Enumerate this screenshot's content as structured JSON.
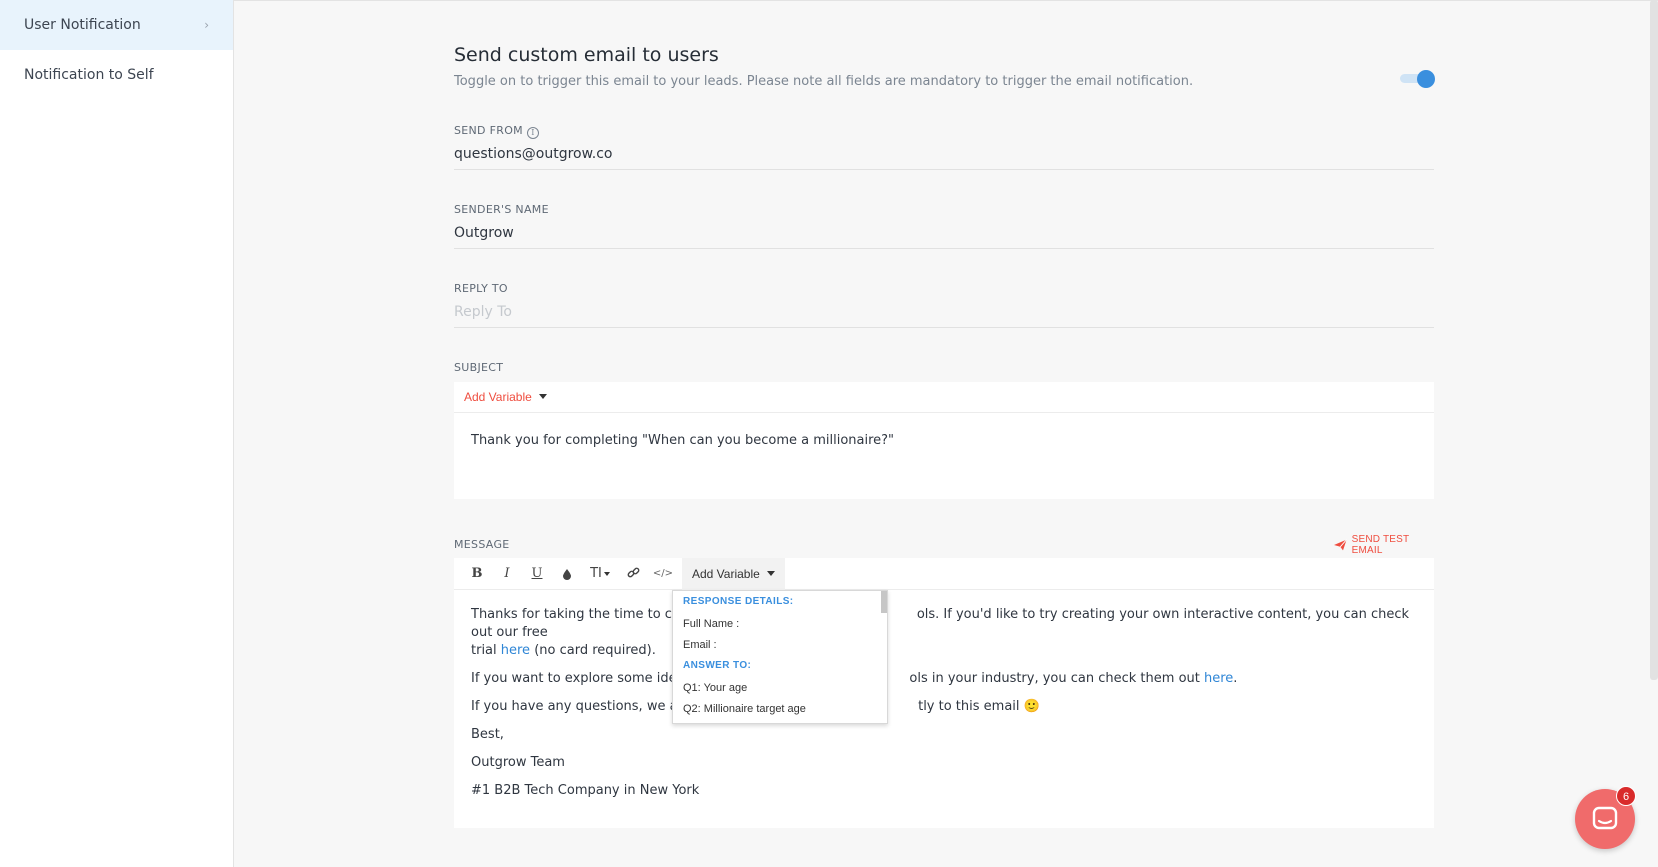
{
  "sidebar": {
    "items": [
      {
        "label": "User Notification",
        "active": true
      },
      {
        "label": "Notification to Self",
        "active": false
      }
    ]
  },
  "section": {
    "title": "Send custom email to users",
    "description": "Toggle on to trigger this email to your leads. Please note all fields are mandatory to trigger the email notification.",
    "toggle_on": true
  },
  "send_from": {
    "label": "SEND FROM",
    "value": "questions@outgrow.co"
  },
  "sender_name": {
    "label": "SENDER'S NAME",
    "value": "Outgrow"
  },
  "reply_to": {
    "label": "REPLY TO",
    "placeholder": "Reply To"
  },
  "subject": {
    "label": "SUBJECT",
    "add_variable": "Add Variable",
    "text": "Thank you for completing \"When can you become a millionaire?\""
  },
  "message": {
    "label": "MESSAGE",
    "send_test": "SEND TEST EMAIL",
    "toolbar": {
      "bold": "B",
      "italic": "I",
      "underline": "U",
      "fontsize": "TI",
      "add_variable": "Add Variable"
    },
    "p1_a": "Thanks for taking the time to comp",
    "p1_b": "ols. If you'd like to try creating your own interactive content, you can check out our free",
    "p1_c": "trial ",
    "p1_link": "here",
    "p1_d": " (no card required).",
    "p2_a": "If you want to explore some ideas",
    "p2_b": "ols in your industry, you can check them out ",
    "p2_link": "here",
    "p2_c": ".",
    "p3_a": "If you have any questions, we are r",
    "p3_b": "tly to this email 🙂",
    "sign_1": "Best,",
    "sign_2": "Outgrow Team",
    "sign_3": "#1 B2B Tech Company in New York"
  },
  "variable_dropdown": {
    "heading_1": "RESPONSE DETAILS:",
    "item_1": "Full Name :",
    "item_2": "Email :",
    "heading_2": "ANSWER TO:",
    "item_3": "Q1: Your age",
    "item_4": "Q2: Millionaire target age"
  },
  "chat": {
    "badge": "6"
  },
  "colors": {
    "accent": "#3a8fde",
    "danger": "#ef4d3f",
    "chat": "#f06b6b"
  }
}
